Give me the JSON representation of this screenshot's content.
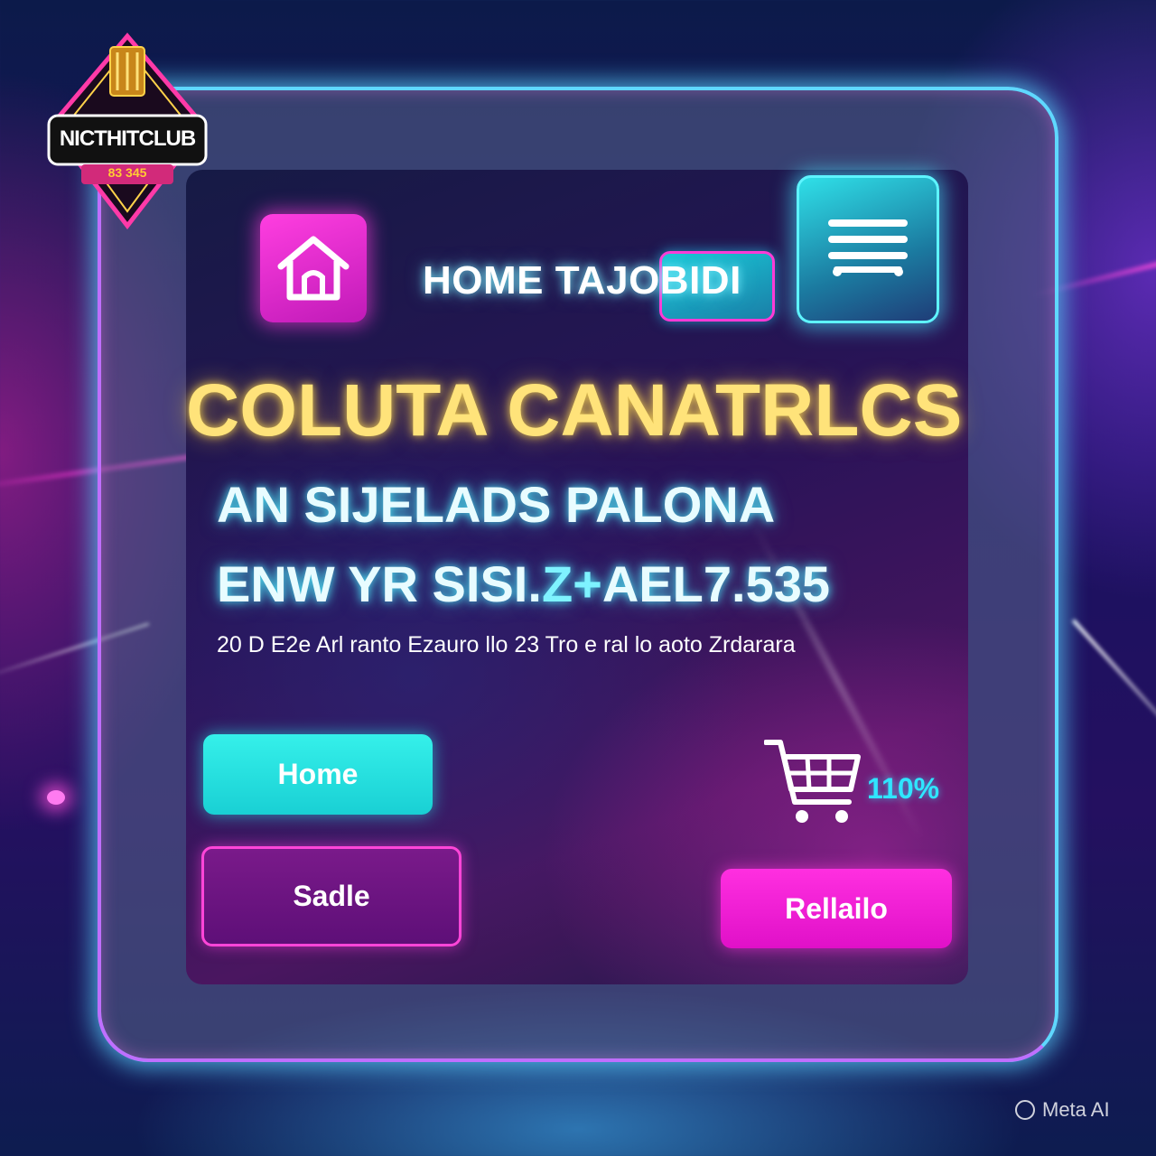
{
  "logo": {
    "text": "NICTHITCLUB",
    "subtext": "83 345"
  },
  "header": {
    "nav_title": "HOME TAJOBIDI"
  },
  "hero": {
    "headline": "COLUTA CANATRLCS",
    "subhead_line1": "AN SIJELADS PALONA",
    "subhead_line2_main": "ENW YR SISI.",
    "subhead_line2_accent": "Z+",
    "subhead_line2_end": "AEL7.535",
    "caption": "20 D E2e Arl ranto Ezauro llo 23 Tro e ral lo aoto Zrdarara"
  },
  "buttons": {
    "home_label": "Home",
    "sadle_label": "Sadle",
    "rellailo_label": "Rellailo"
  },
  "cart": {
    "percent": "110%"
  },
  "watermark": {
    "text": "Meta AI"
  },
  "colors": {
    "accent_cyan": "#35f0ea",
    "accent_magenta": "#ff2fe0",
    "headline_gold": "#ffe37a",
    "frame_glow": "#5fd8ff"
  },
  "icons": [
    "home-icon",
    "menu-icon",
    "shopping-cart-icon",
    "nightclub-crown-logo"
  ]
}
